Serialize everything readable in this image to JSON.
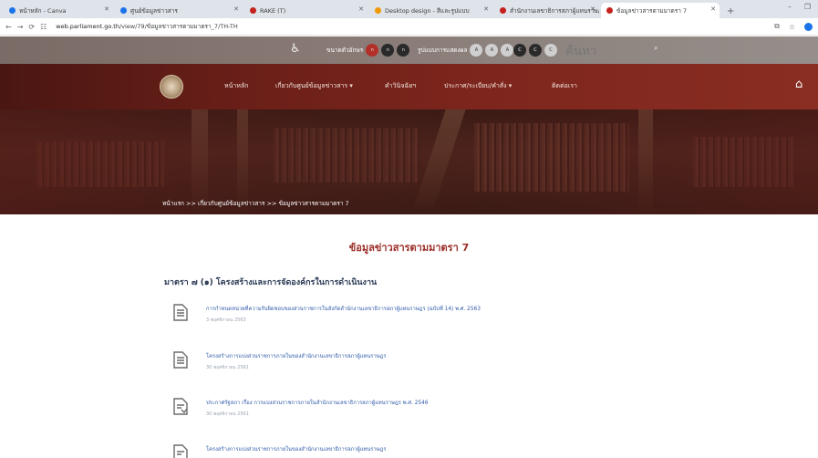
{
  "browser": {
    "tabs": [
      {
        "label": "หน้าหลัก - Canva",
        "color": "#1a73e8"
      },
      {
        "label": "ศูนย์ข้อมูลข่าวสาร",
        "color": "#1a73e8"
      },
      {
        "label": "RAKE (T)",
        "color": "#c5221f"
      },
      {
        "label": "Desktop design - สีและรูปแบบ",
        "color": "#f29900"
      },
      {
        "label": "สำนักงานเลขาธิการสภาผู้แทนราษฎร",
        "color": "#c5221f"
      },
      {
        "label": "ข้อมูลข่าวสารตามมาตรา 7",
        "color": "#c5221f"
      }
    ],
    "new_tab": "+",
    "url_domain": "web.parliament.go.th",
    "url_path": "/view/79/ข้อมูลข่าวสารตามมาตรา_7/TH-TH"
  },
  "utility": {
    "font_size_label": "ขนาดตัวอักษร",
    "font_size_options": [
      "ก",
      "ก",
      "ก"
    ],
    "display_label": "รูปแบบการแสดงผล",
    "display_options": [
      "A",
      "A",
      "A"
    ],
    "contrast_options": [
      "C",
      "C",
      "C"
    ],
    "search_placeholder": "ค้นหา"
  },
  "nav": {
    "items": [
      "หน้าหลัก",
      "เกี่ยวกับศูนย์ข้อมูลข่าวสาร",
      "คำวินิจฉัยฯ",
      "ประกาศ/ระเบียบ/คำสั่ง",
      "ติดต่อเรา"
    ],
    "dropdown_glyph": "▾"
  },
  "breadcrumb": "หน้าแรก >> เกี่ยวกับศูนย์ข้อมูลข่าวสาร >> ข้อมูลข่าวสารตามมาตรา 7",
  "page_title": "ข้อมูลข่าวสารตามมาตรา 7",
  "section_heading": "มาตรา ๗ (๑) โครงสร้างและการจัดองค์กรในการดำเนินงาน",
  "documents": [
    {
      "title": "การกำหนดหน่วยที่ความรับผิดชอบของส่วนราชการในสังกัดสำนักงานเลขาธิการสภาผู้แทนราษฎร (ฉบับที่ 14) พ.ศ. 2563",
      "date": "3 พฤศจิกายน 2563"
    },
    {
      "title": "โครงสร้างการแบ่งส่วนราชการภายในของสำนักงานเลขาธิการสภาผู้แทนราษฎร",
      "date": "30 พฤศจิกายน 2561"
    },
    {
      "title": "ประกาศรัฐสภา เรื่อง การแบ่งส่วนราชการภายในสำนักงานเลขาธิการสภาผู้แทนราษฎร พ.ศ. 2546",
      "date": "30 พฤศจิกายน 2561"
    },
    {
      "title": "โครงสร้างการแบ่งส่วนราชการภายในของสำนักงานเลขาธิการสภาผู้แทนราษฎร",
      "date": ""
    }
  ],
  "colors": {
    "title_red": "#9a2d27",
    "nav_maroon": "#6a1f18",
    "link_blue": "#2f5aa8"
  }
}
